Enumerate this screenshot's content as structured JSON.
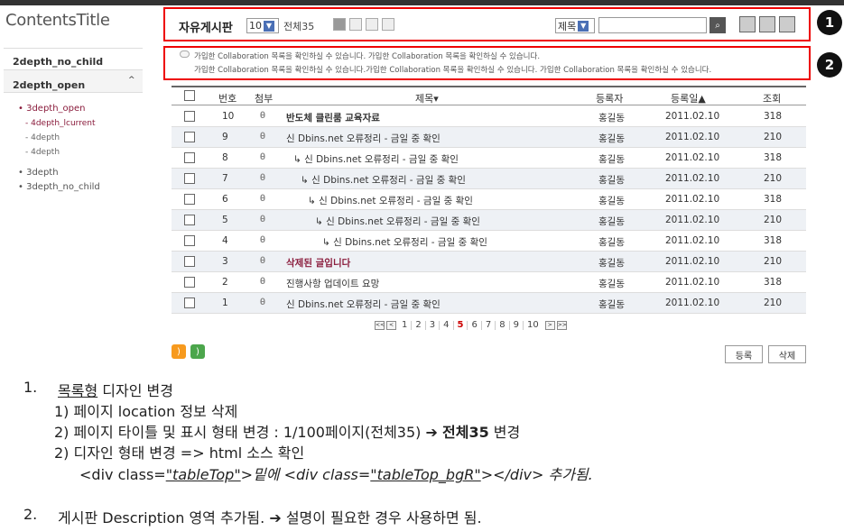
{
  "lnb": {
    "title": "ContentsTitle",
    "item1": "2depth_no_child",
    "item2": "2depth_open",
    "sub1": "3depth_open",
    "sub1a": "4depth_lcurrent",
    "sub1b": "4depth",
    "sub1c": "4depth",
    "sub2": "3depth",
    "sub3": "3depth_no_child"
  },
  "tabletop": {
    "title": "자유게시판",
    "page_size": "10",
    "total": "전체35",
    "search_field": "제목"
  },
  "markers": [
    "1",
    "2"
  ],
  "description": {
    "line1": "가입한 Collaboration 목록을 확인하실 수 있습니다. 가입한 Collaboration 목록을 확인하실 수 있습니다.",
    "line2": "가입한 Collaboration 목록을 확인하실 수 있습니다.가입한 Collaboration 목록을 확인하실 수 있습니다. 가입한 Collaboration 목록을 확인하실 수 있습니다."
  },
  "table": {
    "headers": {
      "no": "번호",
      "attach": "첨부",
      "subject": "제목▾",
      "writer": "등록자",
      "date": "등록일▲",
      "views": "조회"
    },
    "rows": [
      {
        "no": "10",
        "subject": "반도체 클린룸 교육자료",
        "writer": "홍길동",
        "date": "2011.02.10",
        "views": "318"
      },
      {
        "no": "9",
        "subject": "신 Dbins.net 오류정리 - 금일 중 확인",
        "writer": "홍길동",
        "date": "2011.02.10",
        "views": "210"
      },
      {
        "no": "8",
        "subject": "↳ 신 Dbins.net 오류정리 - 금일 중 확인",
        "writer": "홍길동",
        "date": "2011.02.10",
        "views": "318"
      },
      {
        "no": "7",
        "subject": "↳ 신 Dbins.net 오류정리 - 금일 중 확인",
        "writer": "홍길동",
        "date": "2011.02.10",
        "views": "210"
      },
      {
        "no": "6",
        "subject": "↳ 신 Dbins.net 오류정리 - 금일 중 확인",
        "writer": "홍길동",
        "date": "2011.02.10",
        "views": "318"
      },
      {
        "no": "5",
        "subject": "↳ 신 Dbins.net 오류정리 - 금일 중 확인",
        "writer": "홍길동",
        "date": "2011.02.10",
        "views": "210"
      },
      {
        "no": "4",
        "subject": "↳ 신 Dbins.net 오류정리 - 금일 중 확인",
        "writer": "홍길동",
        "date": "2011.02.10",
        "views": "318"
      },
      {
        "no": "3",
        "subject": "삭제된 글입니다",
        "writer": "홍길동",
        "date": "2011.02.10",
        "views": "210"
      },
      {
        "no": "2",
        "subject": "진행사항 업데이트 요망",
        "writer": "홍길동",
        "date": "2011.02.10",
        "views": "318"
      },
      {
        "no": "1",
        "subject": "신 Dbins.net 오류정리 - 금일 중 확인",
        "writer": "홍길동",
        "date": "2011.02.10",
        "views": "210"
      }
    ]
  },
  "pager": {
    "pages": [
      "1",
      "2",
      "3",
      "4",
      "5",
      "6",
      "7",
      "8",
      "9",
      "10"
    ],
    "current": "5"
  },
  "buttons": {
    "register": "등록",
    "delete": "삭제"
  },
  "notes": {
    "n1_num": "1.",
    "n1_a": "목록형",
    "n1_b": " 디자인 변경",
    "n1_l1": "1) 페이지 location 정보 삭제",
    "n1_l2a": "2) 페이지 타이틀 및 표시 형태 변경 : 1/100페이지(전체35) ",
    "n1_l2arrow": "➔",
    "n1_l2b": "전체35",
    "n1_l2c": " 변경",
    "n1_l3": "2) 디자인 형태 변경 => html 소스 확인",
    "n1_l4a": "<div class=",
    "n1_l4b": "\"tableTop\"",
    "n1_l4c": ">밑에 <div class=",
    "n1_l4d": "\"tableTop_bgR\"",
    "n1_l4e": "></div>  추가됨.",
    "n2_num": "2.",
    "n2_a": "게시판 Description 영역 추가됨. ",
    "n2_arrow": "➔",
    "n2_b": " 설명이 필요한 경우 사용하면 됨."
  },
  "colors": {
    "annotation": "#e00000",
    "active_menu": "#8a1c3c",
    "alt_row": "#eef1f5"
  }
}
